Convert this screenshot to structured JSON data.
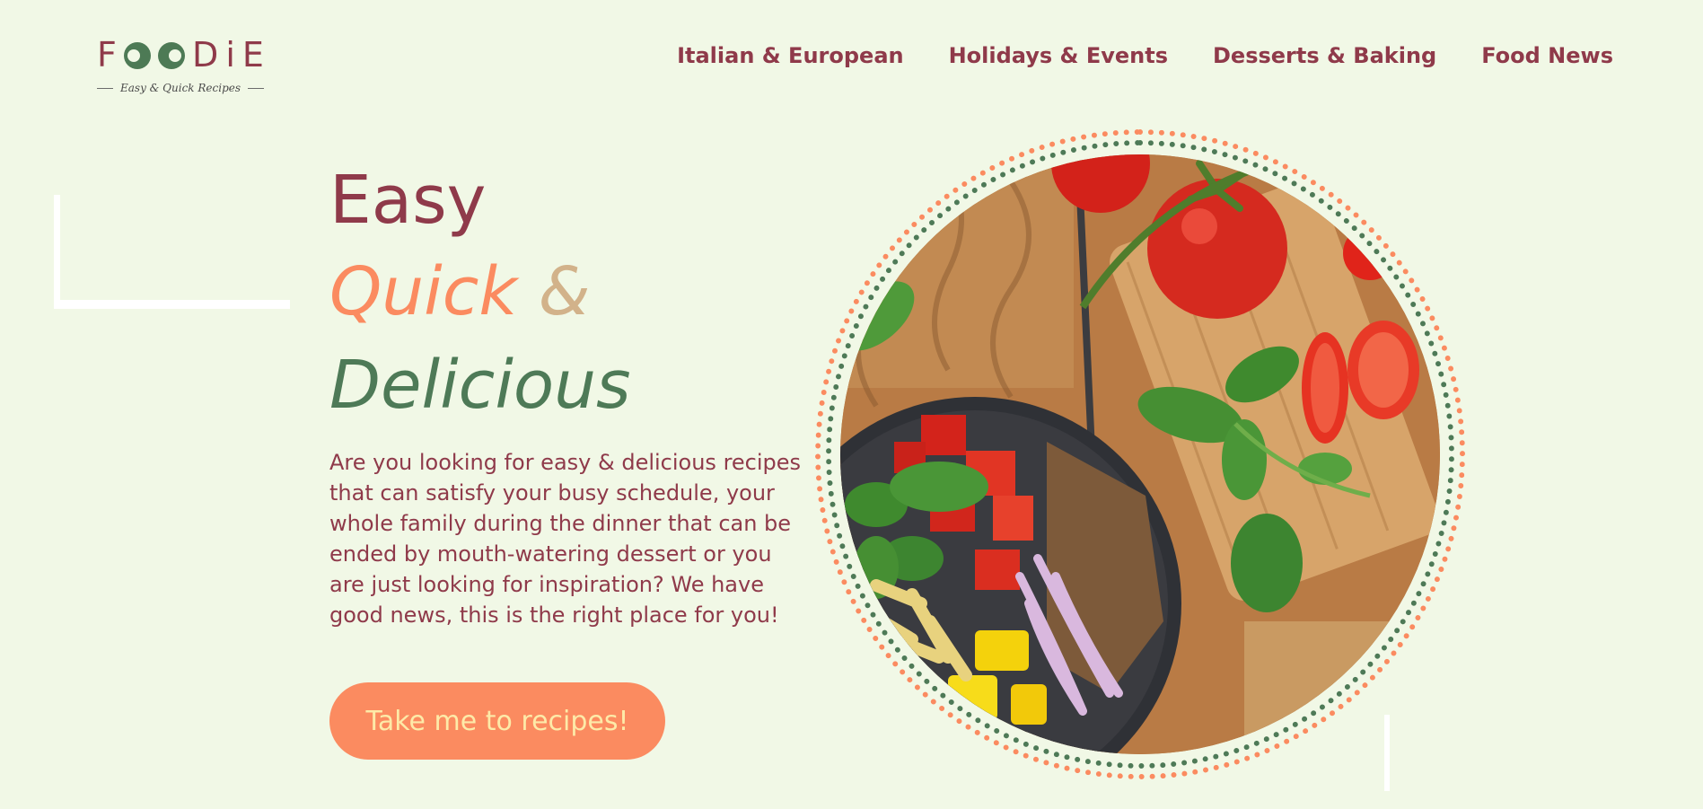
{
  "brand": {
    "name": "FOODIE",
    "tagline": "Easy & Quick Recipes"
  },
  "nav": {
    "items": [
      {
        "label": "Italian & European"
      },
      {
        "label": "Holidays & Events"
      },
      {
        "label": "Desserts & Baking"
      },
      {
        "label": "Food News"
      }
    ]
  },
  "hero": {
    "line1": "Easy",
    "line2_word": "Quick",
    "line2_amp": "&",
    "line3": "Delicious",
    "description": "Are you looking for easy & delicious recipes that can satisfy your busy schedule, your whole family during the dinner that can be ended by mouth-watering dessert or you are just looking for inspiration? We have good news, this is the right place for you!",
    "cta_label": "Take me to recipes!"
  },
  "colors": {
    "background": "#f1f8e6",
    "primary": "#8f3a4a",
    "accent": "#fb8b60",
    "green": "#4e7a57",
    "sand": "#d2b28a",
    "cta_text": "#fdeaa8"
  }
}
